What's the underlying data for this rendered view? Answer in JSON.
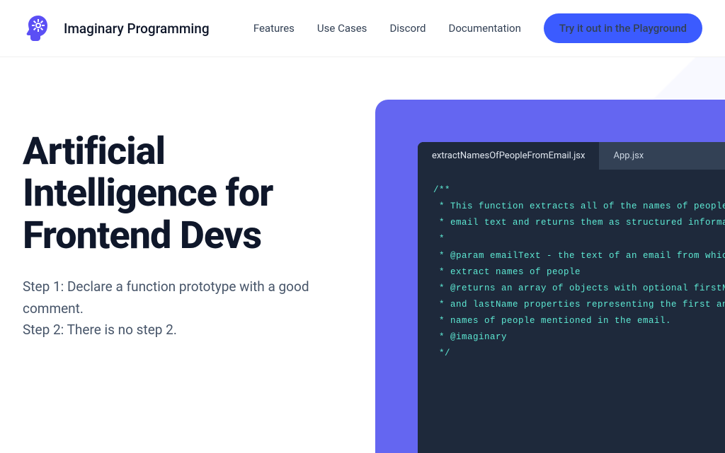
{
  "brand": "Imaginary Programming",
  "nav": {
    "features": "Features",
    "useCases": "Use Cases",
    "discord": "Discord",
    "docs": "Documentation",
    "cta": "Try it out in the Playground"
  },
  "hero": {
    "title": "Artificial Intelligence for Frontend Devs",
    "step1": "Step 1: Declare a function prototype with a good comment.",
    "step2": "Step 2: There is no step 2."
  },
  "editor": {
    "tab1": "extractNamesOfPeopleFromEmail.jsx",
    "tab2": "App.jsx",
    "code": "/**\n * This function extracts all of the names of people\n * email text and returns them as structured informa\n *\n * @param emailText - the text of an email from whic\n * extract names of people\n * @returns an array of objects with optional firstN\n * and lastName properties representing the first an\n * names of people mentioned in the email.\n * @imaginary\n */"
  }
}
